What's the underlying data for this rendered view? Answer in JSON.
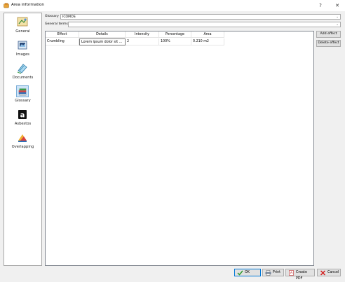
{
  "window": {
    "title": "Area information",
    "help": "?",
    "close": "✕"
  },
  "sidebar": {
    "items": [
      {
        "label": "General",
        "icon": "general-icon"
      },
      {
        "label": "Images",
        "icon": "images-icon"
      },
      {
        "label": "Documents",
        "icon": "documents-icon"
      },
      {
        "label": "Glossary",
        "icon": "glossary-icon",
        "selected": true
      },
      {
        "label": "Asbestos",
        "icon": "asbestos-icon"
      },
      {
        "label": "Overlapping",
        "icon": "overlapping-icon"
      }
    ]
  },
  "glossary": {
    "label": "Glossary",
    "value": "ICOMOS"
  },
  "general_terms": {
    "label": "General terms",
    "value": ""
  },
  "table": {
    "columns": [
      "Effect",
      "Details",
      "Intensity",
      "Percentage",
      "Area"
    ],
    "rows": [
      [
        "Crumbling",
        "Lorem ipsum dolor sit ...",
        "2",
        "100%",
        "0.210 m2"
      ]
    ]
  },
  "actions": {
    "add_effect": "Add effect",
    "delete_effect": "Delete effect"
  },
  "footer": {
    "ok": "OK",
    "print": "Print",
    "create_pdf": "Create PDF",
    "cancel": "Cancel"
  },
  "colors": {
    "accent": "#0078d7",
    "ok_icon": "#2e9a2e",
    "cancel_icon": "#d22020"
  }
}
